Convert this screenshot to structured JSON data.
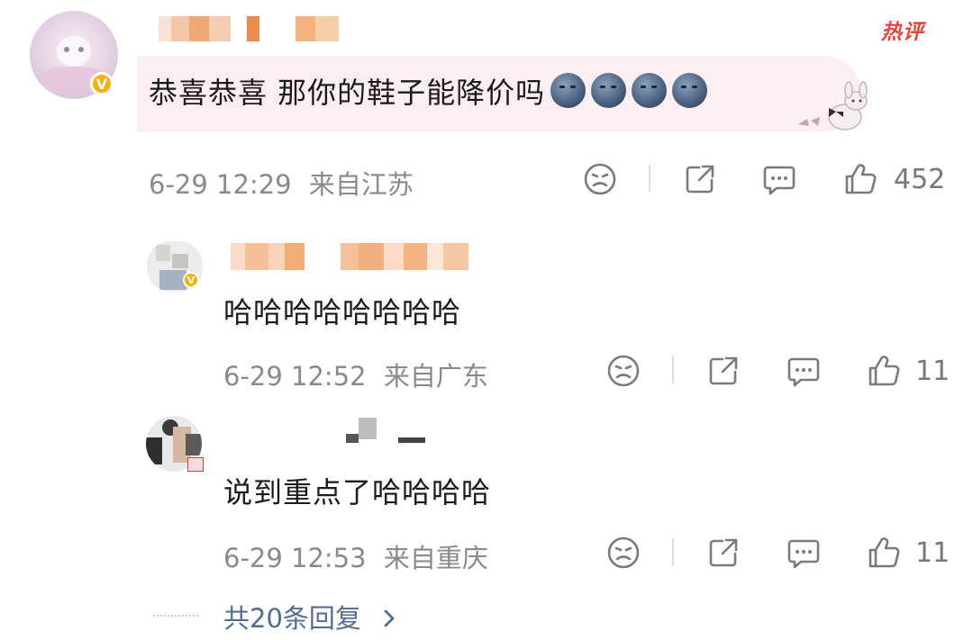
{
  "hot_label": "热评",
  "comments": [
    {
      "text": "恭喜恭喜 那你的鞋子能降价吗",
      "emoji_icon": "new-moon-face-emoji",
      "emoji_count": 4,
      "date": "6-29 12:29",
      "location": "来自江苏",
      "likes": "452"
    },
    {
      "text": "哈哈哈哈哈哈哈哈",
      "date": "6-29 12:52",
      "location": "来自广东",
      "likes": "11"
    },
    {
      "text": "说到重点了哈哈哈哈",
      "date": "6-29 12:53",
      "location": "来自重庆",
      "likes": "11"
    }
  ],
  "more_replies": "共20条回复",
  "colors": {
    "bubble": "#fbeff3",
    "hot": "#e8443d",
    "link": "#4f6c96",
    "meta": "#8a8a8a",
    "verified": "#f6b10a"
  },
  "icons": [
    "dislike-icon",
    "share-icon",
    "comment-icon",
    "like-icon",
    "chevron-right-icon"
  ]
}
